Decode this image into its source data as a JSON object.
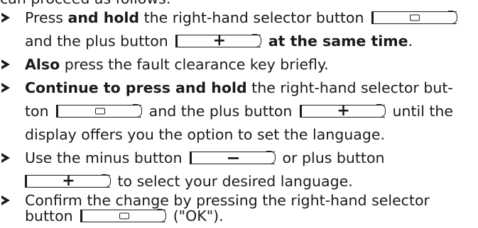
{
  "intro_cut": "can proceed as follows:",
  "steps": [
    {
      "line1_a": "Press ",
      "line1_b": "and hold",
      "line1_c": " the right-hand selector button",
      "line2_a": " and the plus button",
      "line2_b": "at the same time",
      "line2_c": "."
    },
    {
      "a": "Also",
      "b": " press the fault clearance key briefly."
    },
    {
      "line1_a": "Continue to press and hold",
      "line1_b": " the right-hand selector but-",
      "line2_a": "ton",
      "line2_b": " and the plus button",
      "line2_c": " until the",
      "line3": "display offers you the option to set the language."
    },
    {
      "line1_a": "Use the minus button",
      "line1_b": " or plus button",
      "line2": " to select your desired language."
    },
    {
      "line1": "Confirm the change by pressing the right-hand selector",
      "line2_a": "button",
      "line2_b": " (\"OK\")."
    }
  ],
  "icons": {
    "selector_glyph": "rounded-rectangle",
    "plus_glyph": "+",
    "minus_glyph": "−"
  }
}
